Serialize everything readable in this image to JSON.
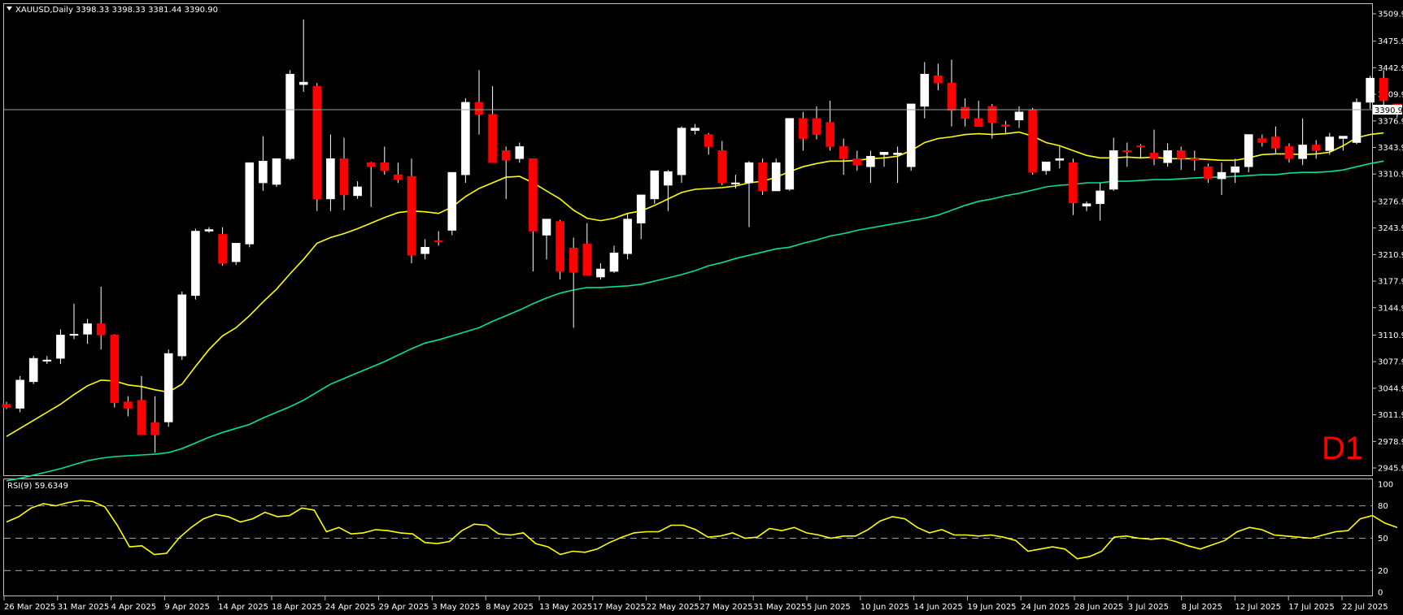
{
  "header": {
    "symbol_title": "XAUUSD,Daily",
    "ohlc_text": "3398.33 3398.33 3381.44 3390.90"
  },
  "timeframe_label": "D1",
  "current_price_label": "3390.90",
  "colors": {
    "background": "#000000",
    "frame": "#c0c0c0",
    "bull_body": "#ffffff",
    "bear_body": "#ff0000",
    "ma_fast": "#ffff00",
    "ma_slow": "#00e0a0",
    "rsi_line": "#ffff00",
    "price_line": "#8fa6b5",
    "d1_label": "#ff0000"
  },
  "chart_data": [
    {
      "type": "candlestick",
      "title": "XAUUSD,Daily",
      "y_ticks": [
        "3509.90",
        "3475.90",
        "3442.90",
        "3409.90",
        "3376.90",
        "3343.90",
        "3310.90",
        "3276.90",
        "3243.90",
        "3210.90",
        "3177.90",
        "3144.90",
        "3110.90",
        "3077.90",
        "3044.90",
        "3011.90",
        "2978.90",
        "2945.90"
      ],
      "ylim": [
        2945.9,
        3509.9
      ],
      "x_labels": [
        "26 Mar 2025",
        "31 Mar 2025",
        "4 Apr 2025",
        "9 Apr 2025",
        "14 Apr 2025",
        "18 Apr 2025",
        "24 Apr 2025",
        "29 Apr 2025",
        "3 May 2025",
        "8 May 2025",
        "13 May 2025",
        "17 May 2025",
        "22 May 2025",
        "27 May 2025",
        "31 May 2025",
        "5 Jun 2025",
        "10 Jun 2025",
        "14 Jun 2025",
        "19 Jun 2025",
        "24 Jun 2025",
        "28 Jun 2025",
        "3 Jul 2025",
        "8 Jul 2025",
        "12 Jul 2025",
        "17 Jul 2025",
        "22 Jul 2025"
      ],
      "current_price": 3390.9,
      "candles": [
        [
          3025,
          3028,
          3019,
          3021
        ],
        [
          3020,
          3060,
          3015,
          3055
        ],
        [
          3053,
          3085,
          3050,
          3082
        ],
        [
          3080,
          3085,
          3075,
          3080
        ],
        [
          3082,
          3118,
          3075,
          3111
        ],
        [
          3111,
          3150,
          3106,
          3112
        ],
        [
          3112,
          3131,
          3100,
          3125
        ],
        [
          3125,
          3171,
          3093,
          3111
        ],
        [
          3111,
          3112,
          3021,
          3027
        ],
        [
          3028,
          3035,
          3010,
          3020
        ],
        [
          3030,
          3060,
          2987,
          2987
        ],
        [
          3002,
          3035,
          2965,
          2987
        ],
        [
          3003,
          3093,
          2997,
          3088
        ],
        [
          3085,
          3165,
          3080,
          3161
        ],
        [
          3160,
          3243,
          3155,
          3240
        ],
        [
          3240,
          3245,
          3238,
          3242
        ],
        [
          3236,
          3245,
          3197,
          3200
        ],
        [
          3202,
          3225,
          3198,
          3225
        ],
        [
          3224,
          3315,
          3220,
          3325
        ],
        [
          3300,
          3358,
          3290,
          3327
        ],
        [
          3298,
          3330,
          3295,
          3330
        ],
        [
          3330,
          3440,
          3328,
          3435
        ],
        [
          3422,
          3503,
          3413,
          3425
        ],
        [
          3420,
          3424,
          3265,
          3280
        ],
        [
          3280,
          3360,
          3265,
          3330
        ],
        [
          3330,
          3356,
          3266,
          3285
        ],
        [
          3284,
          3302,
          3280,
          3295
        ],
        [
          3325,
          3326,
          3270,
          3320
        ],
        [
          3325,
          3345,
          3310,
          3315
        ],
        [
          3310,
          3325,
          3300,
          3304
        ],
        [
          3308,
          3330,
          3200,
          3210
        ],
        [
          3212,
          3230,
          3205,
          3220
        ],
        [
          3228,
          3240,
          3222,
          3227
        ],
        [
          3241,
          3302,
          3235,
          3313
        ],
        [
          3310,
          3405,
          3300,
          3400
        ],
        [
          3400,
          3440,
          3360,
          3385
        ],
        [
          3385,
          3420,
          3330,
          3325
        ],
        [
          3340,
          3345,
          3280,
          3328
        ],
        [
          3330,
          3350,
          3325,
          3345
        ],
        [
          3330,
          3330,
          3190,
          3240
        ],
        [
          3235,
          3250,
          3205,
          3255
        ],
        [
          3252,
          3254,
          3180,
          3190
        ],
        [
          3219,
          3232,
          3120,
          3189
        ],
        [
          3224,
          3250,
          3185,
          3185
        ],
        [
          3183,
          3200,
          3180,
          3193
        ],
        [
          3190,
          3222,
          3188,
          3213
        ],
        [
          3212,
          3262,
          3205,
          3255
        ],
        [
          3250,
          3285,
          3230,
          3285
        ],
        [
          3280,
          3315,
          3274,
          3315
        ],
        [
          3297,
          3316,
          3265,
          3314
        ],
        [
          3310,
          3370,
          3300,
          3368
        ],
        [
          3365,
          3373,
          3360,
          3368
        ],
        [
          3360,
          3362,
          3335,
          3345
        ],
        [
          3340,
          3352,
          3297,
          3300
        ],
        [
          3300,
          3310,
          3293,
          3300
        ],
        [
          3300,
          3327,
          3245,
          3325
        ],
        [
          3325,
          3330,
          3285,
          3290
        ],
        [
          3290,
          3330,
          3290,
          3325
        ],
        [
          3292,
          3380,
          3290,
          3380
        ],
        [
          3380,
          3388,
          3340,
          3355
        ],
        [
          3380,
          3395,
          3354,
          3360
        ],
        [
          3375,
          3402,
          3340,
          3345
        ],
        [
          3345,
          3355,
          3310,
          3330
        ],
        [
          3330,
          3340,
          3315,
          3322
        ],
        [
          3320,
          3340,
          3300,
          3333
        ],
        [
          3335,
          3338,
          3320,
          3338
        ],
        [
          3335,
          3345,
          3300,
          3337
        ],
        [
          3320,
          3390,
          3315,
          3398
        ],
        [
          3395,
          3450,
          3380,
          3435
        ],
        [
          3433,
          3448,
          3415,
          3424
        ],
        [
          3424,
          3453,
          3370,
          3390
        ],
        [
          3394,
          3405,
          3370,
          3380
        ],
        [
          3380,
          3402,
          3375,
          3370
        ],
        [
          3395,
          3398,
          3355,
          3375
        ],
        [
          3372,
          3377,
          3360,
          3370
        ],
        [
          3378,
          3395,
          3368,
          3388
        ],
        [
          3391,
          3393,
          3310,
          3313
        ],
        [
          3315,
          3322,
          3310,
          3326
        ],
        [
          3328,
          3345,
          3318,
          3330
        ],
        [
          3325,
          3330,
          3260,
          3275
        ],
        [
          3271,
          3277,
          3265,
          3274
        ],
        [
          3274,
          3300,
          3253,
          3290
        ],
        [
          3292,
          3356,
          3290,
          3340
        ],
        [
          3340,
          3350,
          3320,
          3339
        ],
        [
          3346,
          3348,
          3330,
          3345
        ],
        [
          3337,
          3366,
          3322,
          3330
        ],
        [
          3325,
          3349,
          3320,
          3340
        ],
        [
          3340,
          3345,
          3316,
          3330
        ],
        [
          3330,
          3340,
          3315,
          3328
        ],
        [
          3320,
          3324,
          3300,
          3305
        ],
        [
          3305,
          3325,
          3285,
          3313
        ],
        [
          3313,
          3330,
          3300,
          3320
        ],
        [
          3320,
          3360,
          3313,
          3360
        ],
        [
          3355,
          3360,
          3345,
          3350
        ],
        [
          3357,
          3370,
          3337,
          3343
        ],
        [
          3345,
          3349,
          3325,
          3330
        ],
        [
          3330,
          3380,
          3322,
          3347
        ],
        [
          3347,
          3353,
          3330,
          3340
        ],
        [
          3340,
          3362,
          3335,
          3357
        ],
        [
          3355,
          3357,
          3340,
          3358
        ],
        [
          3350,
          3405,
          3348,
          3400
        ],
        [
          3400,
          3433,
          3392,
          3430
        ],
        [
          3430,
          3440,
          3396,
          3402
        ],
        [
          3398,
          3398,
          3381,
          3390.9
        ]
      ],
      "series": [
        {
          "values": [
            2985,
            2995,
            3005,
            3015,
            3025,
            3037,
            3048,
            3055,
            3054,
            3049,
            3047,
            3043,
            3040,
            3050,
            3072,
            3093,
            3110,
            3120,
            3135,
            3152,
            3168,
            3187,
            3205,
            3225,
            3232,
            3237,
            3243,
            3250,
            3257,
            3263,
            3265,
            3264,
            3262,
            3270,
            3283,
            3293,
            3300,
            3307,
            3308,
            3300,
            3290,
            3280,
            3266,
            3256,
            3253,
            3256,
            3262,
            3265,
            3272,
            3280,
            3288,
            3292,
            3293,
            3294,
            3296,
            3300,
            3302,
            3307,
            3314,
            3320,
            3324,
            3327,
            3327,
            3328,
            3330,
            3331,
            3333,
            3340,
            3350,
            3355,
            3357,
            3360,
            3361,
            3360,
            3361,
            3363,
            3358,
            3350,
            3346,
            3340,
            3334,
            3331,
            3331,
            3332,
            3331,
            3332,
            3330,
            3330,
            3330,
            3329,
            3328,
            3328,
            3331,
            3335,
            3336,
            3336,
            3335,
            3336,
            3338,
            3346,
            3356,
            3360,
            3362
          ]
        },
        {
          "values": [
            2930,
            2933,
            2937,
            2941,
            2945,
            2950,
            2955,
            2958,
            2960,
            2961,
            2962,
            2963,
            2965,
            2970,
            2977,
            2984,
            2990,
            2995,
            3000,
            3008,
            3015,
            3022,
            3030,
            3040,
            3050,
            3057,
            3064,
            3071,
            3078,
            3086,
            3094,
            3101,
            3105,
            3110,
            3115,
            3120,
            3128,
            3135,
            3142,
            3150,
            3157,
            3163,
            3167,
            3170,
            3170,
            3171,
            3172,
            3174,
            3178,
            3182,
            3186,
            3191,
            3197,
            3201,
            3206,
            3210,
            3214,
            3218,
            3220,
            3225,
            3229,
            3234,
            3237,
            3241,
            3244,
            3247,
            3250,
            3253,
            3256,
            3260,
            3266,
            3272,
            3277,
            3280,
            3284,
            3287,
            3291,
            3295,
            3297,
            3298,
            3300,
            3300,
            3302,
            3302,
            3303,
            3304,
            3304,
            3305,
            3306,
            3307,
            3307,
            3308,
            3309,
            3310,
            3310,
            3312,
            3313,
            3313,
            3314,
            3316,
            3320,
            3324,
            3327
          ]
        }
      ]
    },
    {
      "type": "line",
      "title": "RSI(9) 59.6349",
      "y_ticks": [
        "100",
        "80",
        "50",
        "20",
        "0"
      ],
      "ylim": [
        0,
        100
      ],
      "levels": [
        80,
        50,
        20
      ],
      "series": [
        {
          "values": [
            65,
            70,
            78,
            82,
            80,
            83,
            85,
            84,
            79,
            62,
            42,
            43,
            35,
            36,
            50,
            60,
            68,
            72,
            70,
            65,
            68,
            74,
            70,
            71,
            78,
            76,
            56,
            60,
            54,
            55,
            58,
            57,
            55,
            54,
            46,
            45,
            47,
            57,
            63,
            62,
            54,
            53,
            55,
            45,
            42,
            35,
            38,
            37,
            40,
            46,
            51,
            55,
            56,
            56,
            62,
            62,
            58,
            51,
            52,
            55,
            50,
            51,
            59,
            57,
            60,
            55,
            53,
            50,
            52,
            52,
            58,
            66,
            70,
            68,
            60,
            55,
            58,
            53,
            53,
            52,
            53,
            51,
            48,
            38,
            40,
            42,
            40,
            31,
            33,
            38,
            51,
            52,
            50,
            49,
            50,
            47,
            43,
            40,
            44,
            48,
            56,
            60,
            58,
            53,
            52,
            51,
            50,
            53,
            56,
            57,
            68,
            71,
            64,
            60
          ]
        }
      ]
    }
  ]
}
